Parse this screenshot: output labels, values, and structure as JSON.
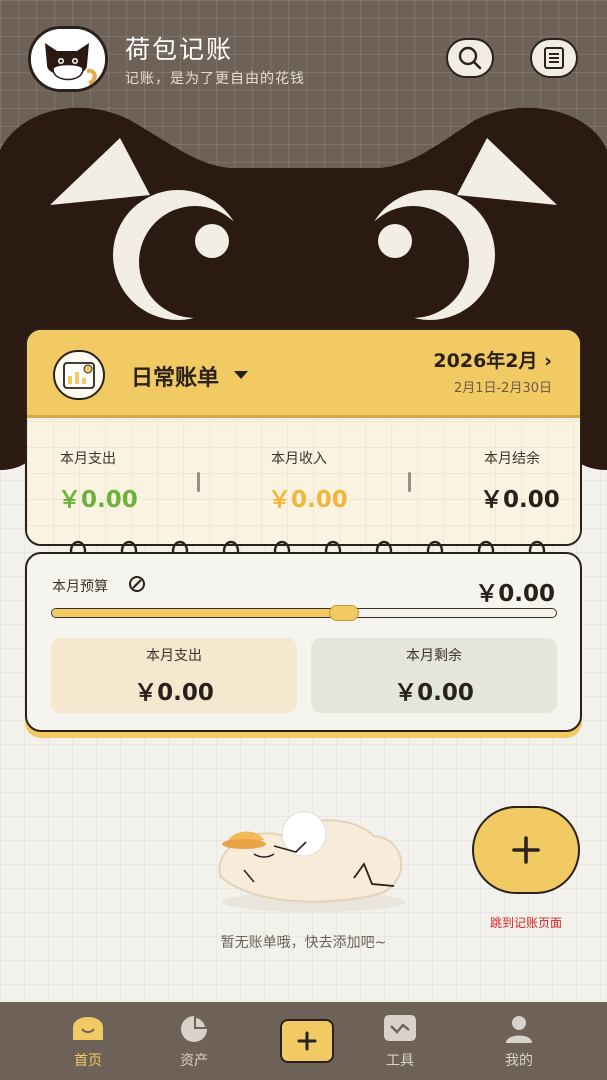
{
  "header": {
    "title": "荷包记账",
    "subtitle": "记账，是为了更自由的花钱",
    "icons": [
      "avatar-cat",
      "search-icon",
      "bill-list-icon"
    ]
  },
  "ledger": {
    "book_name": "日常账单",
    "period_month": "2026年2月",
    "period_range": "2月1日-2月30日",
    "stats": [
      {
        "label": "本月支出",
        "value": "￥0.00",
        "color": "#6cb23a"
      },
      {
        "label": "本月收入",
        "value": "￥0.00",
        "color": "#f2b63c"
      },
      {
        "label": "本月结余",
        "value": "￥0.00",
        "color": "#2a211b"
      }
    ]
  },
  "budget": {
    "label": "本月预算",
    "total": "￥0.00",
    "progress_percent": 58,
    "expense_label": "本月支出",
    "expense_value": "￥0.00",
    "remaining_label": "本月剩余",
    "remaining_value": "￥0.00"
  },
  "empty_state": {
    "text": "暂无账单哦，快去添加吧~"
  },
  "fab": {
    "caption": "跳到记账页面"
  },
  "tabbar": {
    "items": [
      {
        "label": "首页",
        "icon": "home-icon",
        "active": true
      },
      {
        "label": "资产",
        "icon": "pie-chart-icon",
        "active": false
      },
      {
        "label": "",
        "icon": "add-icon",
        "active": false
      },
      {
        "label": "工具",
        "icon": "tools-icon",
        "active": false
      },
      {
        "label": "我的",
        "icon": "user-icon",
        "active": false
      }
    ],
    "active_color": "#f2ca63",
    "inactive_color": "#d9d2ca"
  },
  "colors": {
    "accent": "#f2ca63",
    "header_bg": "#6e6258",
    "dark": "#2a211b",
    "caption_red": "#d82424"
  }
}
